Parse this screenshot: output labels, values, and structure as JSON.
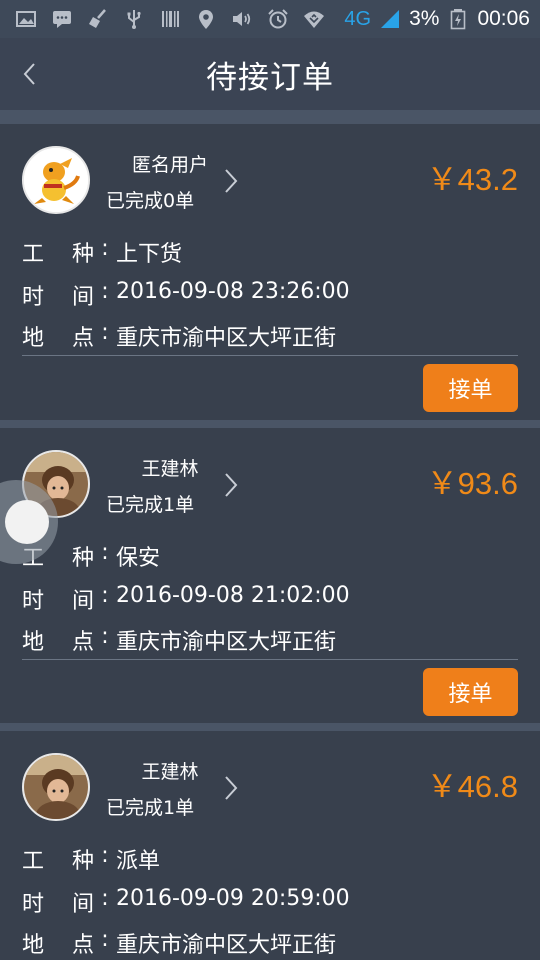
{
  "status_bar": {
    "network": "4G",
    "battery_percent": "3%",
    "time": "00:06"
  },
  "header": {
    "title": "待接订单"
  },
  "labels": {
    "type_a": "工",
    "type_b": "种",
    "time_a": "时",
    "time_b": "间",
    "place_a": "地",
    "place_b": "点",
    "colon": ":"
  },
  "orders": [
    {
      "user": "匿名用户",
      "completed": "已完成0单",
      "price": "￥43.2",
      "job_type": "上下货",
      "time": "2016-09-08 23:26:00",
      "location": "重庆市渝中区大坪正街",
      "accept_label": "接单"
    },
    {
      "user": "王建林",
      "completed": "已完成1单",
      "price": "￥93.6",
      "job_type": "保安",
      "time": "2016-09-08 21:02:00",
      "location": "重庆市渝中区大坪正街",
      "accept_label": "接单"
    },
    {
      "user": "王建林",
      "completed": "已完成1单",
      "price": "￥46.8",
      "job_type": "派单",
      "time": "2016-09-09 20:59:00",
      "location": "重庆市渝中区大坪正街",
      "accept_label": "接单"
    }
  ],
  "colors": {
    "background": "#38404d",
    "accent": "#ef7f1a",
    "price": "#f08a18",
    "network": "#29a3e8"
  }
}
